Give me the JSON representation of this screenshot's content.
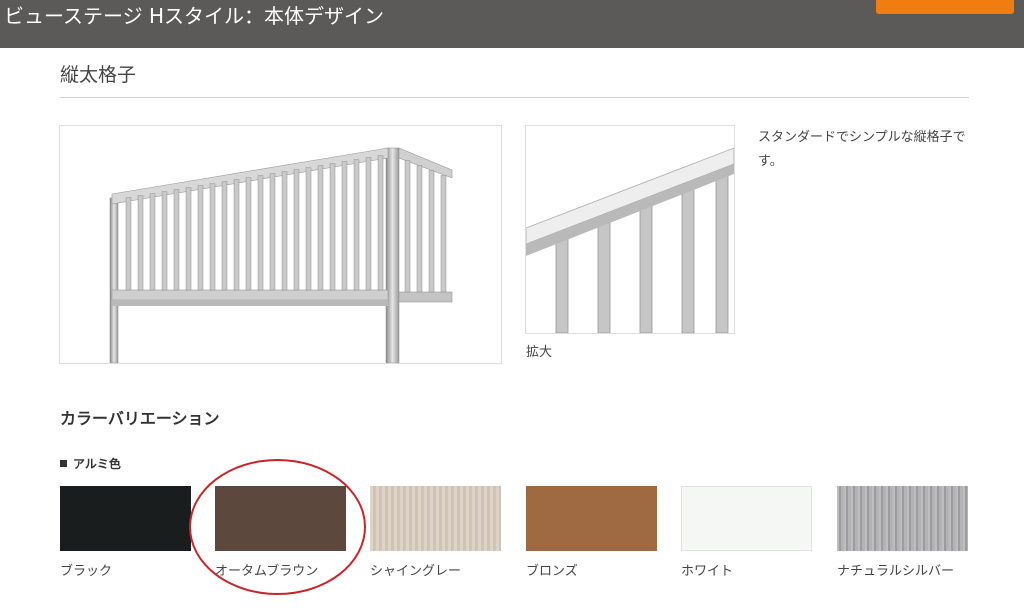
{
  "header": {
    "title": "ビューステージ Hスタイル：本体デザイン"
  },
  "section": {
    "title": "縦太格子"
  },
  "images": {
    "zoom_caption": "拡大"
  },
  "description": "スタンダードでシンプルな縦格子です。",
  "color_variation": {
    "title": "カラーバリエーション",
    "category": "アルミ色",
    "swatches": [
      {
        "name": "ブラック",
        "color": "#1a1d1d"
      },
      {
        "name": "オータムブラウン",
        "color": "#5c483d",
        "highlighted": true
      },
      {
        "name": "シャイングレー",
        "color": "#d6cbbb"
      },
      {
        "name": "ブロンズ",
        "color": "#9f6a42"
      },
      {
        "name": "ホワイト",
        "color": "#f5f7f5"
      },
      {
        "name": "ナチュラルシルバー",
        "color": "#a9a9ab"
      }
    ]
  },
  "colors": {
    "topbar": "#5b5a58",
    "accent": "#ef7d10",
    "highlight": "#c8242a"
  }
}
